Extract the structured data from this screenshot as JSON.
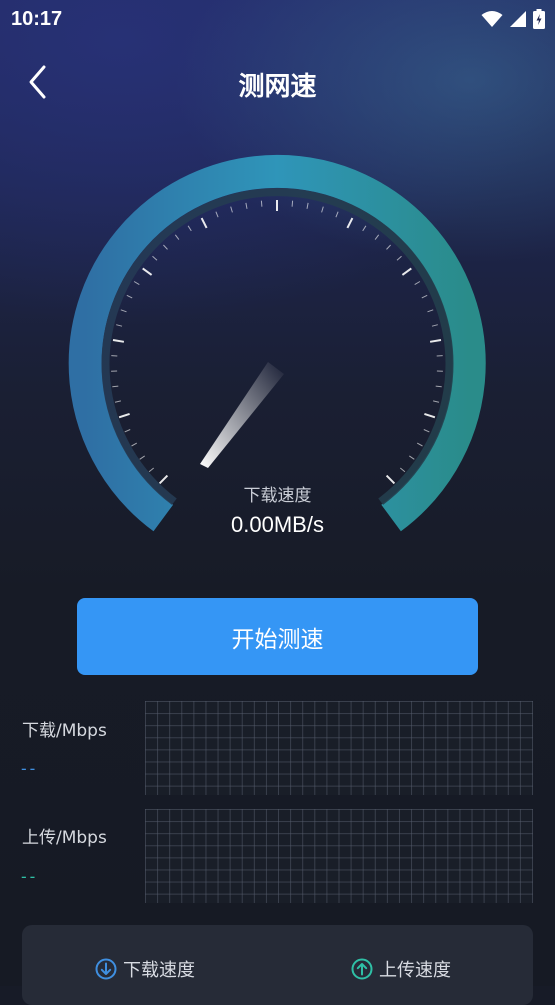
{
  "status_bar": {
    "time": "10:17",
    "icons": [
      "wifi-icon",
      "signal-icon",
      "battery-icon"
    ]
  },
  "header": {
    "title": "测网速",
    "back_icon": "chevron-left-icon"
  },
  "gauge": {
    "label": "下载速度",
    "value": "0.00MB/s",
    "level": 0,
    "colors": {
      "arc_start": "#2f6fa4",
      "arc_mid": "#2f95b9",
      "arc_end": "#2a8c8a"
    }
  },
  "start_button": {
    "label": "开始测速",
    "color": "#3596f5"
  },
  "download": {
    "label": "下载/Mbps",
    "value": "--",
    "color": "#3f8fe0"
  },
  "upload": {
    "label": "上传/Mbps",
    "value": "--",
    "color": "#2fc0a6"
  },
  "tabs": [
    {
      "label": "下载速度",
      "icon": "arrow-down-circle-icon",
      "color": "#3f8fe0"
    },
    {
      "label": "上传速度",
      "icon": "arrow-up-circle-icon",
      "color": "#2fc0a6"
    }
  ]
}
